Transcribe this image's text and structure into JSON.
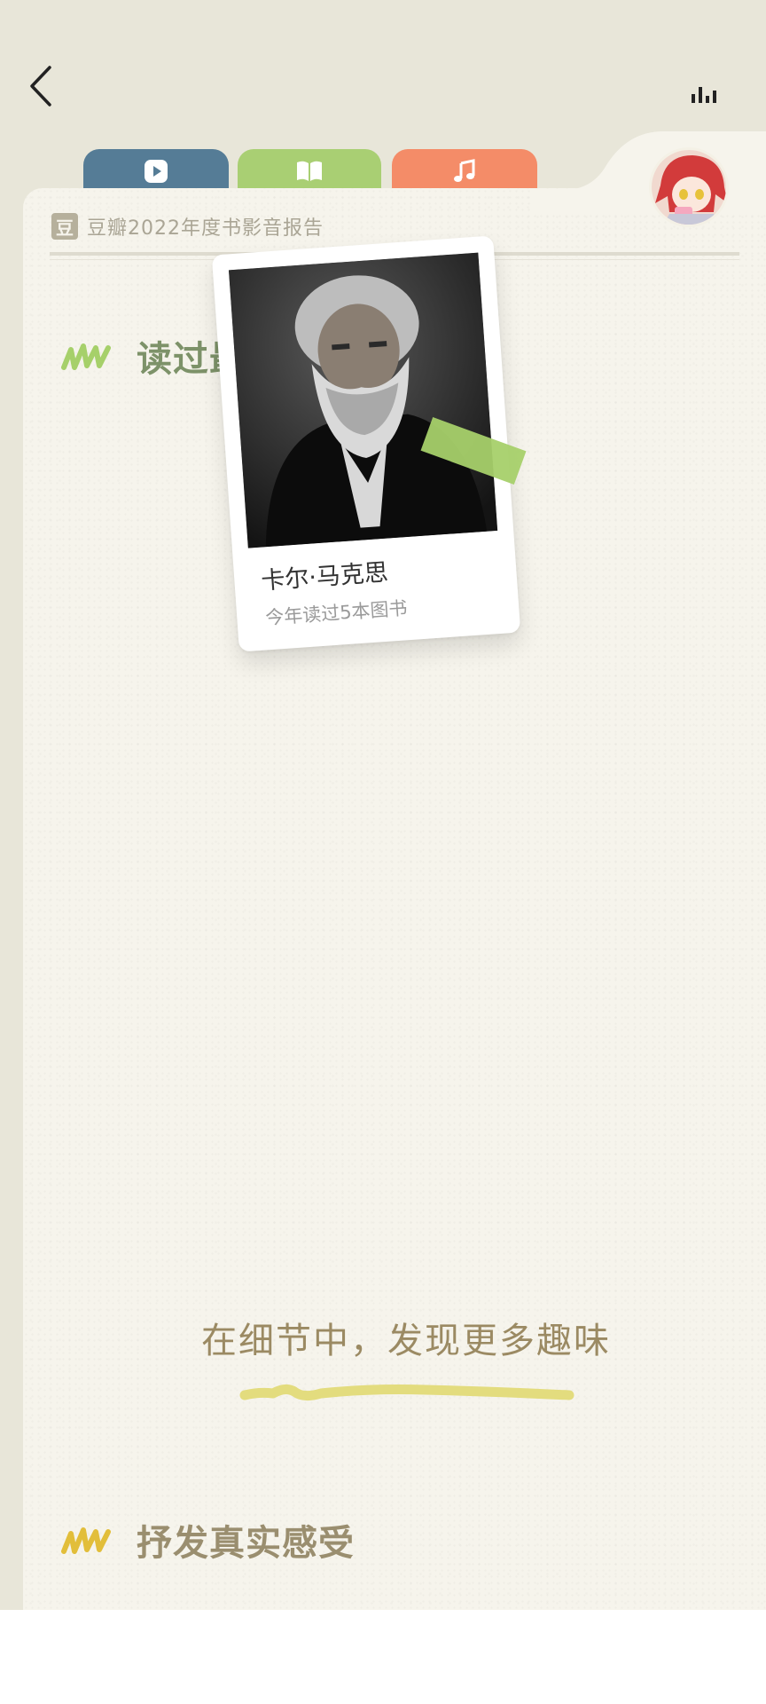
{
  "topbar": {
    "back_icon": "chevron-left-icon",
    "stats_icon": "bar-chart-icon"
  },
  "tabs": [
    {
      "name": "video",
      "icon": "play-icon",
      "color": "#557c96"
    },
    {
      "name": "book",
      "icon": "open-book-icon",
      "color": "#a9cf73"
    },
    {
      "name": "music",
      "icon": "music-note-icon",
      "color": "#f48c68"
    }
  ],
  "header": {
    "logo_char": "豆",
    "title": "豆瓣2022年度书影音报告"
  },
  "section1": {
    "title": "读过最多的作者",
    "accent": "#7d9269"
  },
  "author": {
    "name": "卡尔·马克思",
    "subtitle": "今年读过5本图书"
  },
  "tagline": "在细节中，发现更多趣味",
  "section2": {
    "title": "抒发真实感受",
    "accent": "#e2be3a"
  }
}
